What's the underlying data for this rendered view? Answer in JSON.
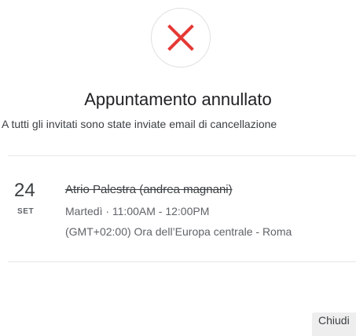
{
  "status": {
    "icon": "close-x-icon",
    "icon_color": "#e53935",
    "title": "Appuntamento annullato",
    "subtitle": "A tutti gli invitati sono state inviate email di cancellazione"
  },
  "event": {
    "day": "24",
    "month": "SET",
    "title": "Atrio Palestra (andrea magnani)",
    "time": "Martedì · 11:00AM - 12:00PM",
    "timezone": "(GMT+02:00) Ora dell’Europa centrale - Roma"
  },
  "actions": {
    "close_label": "Chiudi"
  }
}
